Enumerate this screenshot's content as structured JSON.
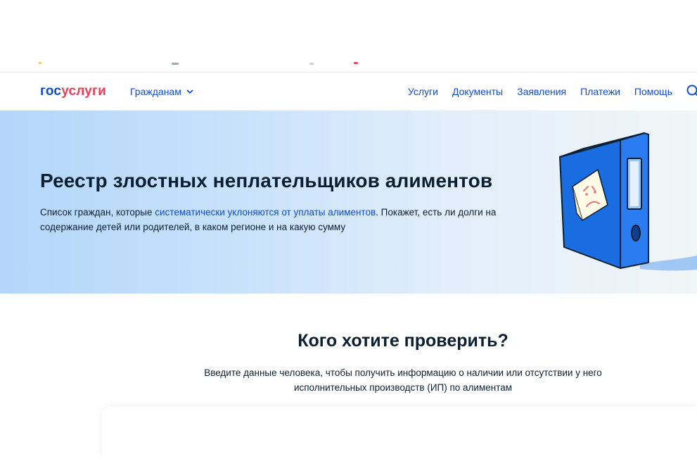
{
  "header": {
    "logo": {
      "part1": "гос",
      "part2": "услуги"
    },
    "audience": "Гражданам",
    "nav": [
      "Услуги",
      "Документы",
      "Заявления",
      "Платежи",
      "Помощь"
    ]
  },
  "hero": {
    "title": "Реестр злостных неплательщиков алиментов",
    "desc_before": "Список граждан, которые ",
    "desc_link": "систематически уклоняются от уплаты алиментов",
    "desc_after": ". Покажет, есть ли долги на содержание детей или родителей, в каком регионе и на какую сумму"
  },
  "check": {
    "title": "Кого хотите проверить?",
    "desc_line1": "Введите данные человека, чтобы получить информацию о наличии или отсутствии у него",
    "desc_line2": "исполнительных производств (ИП) по алиментам"
  },
  "colors": {
    "brand_blue": "#0d4cd3",
    "brand_red": "#ee3f58",
    "text": "#0b1f33"
  }
}
